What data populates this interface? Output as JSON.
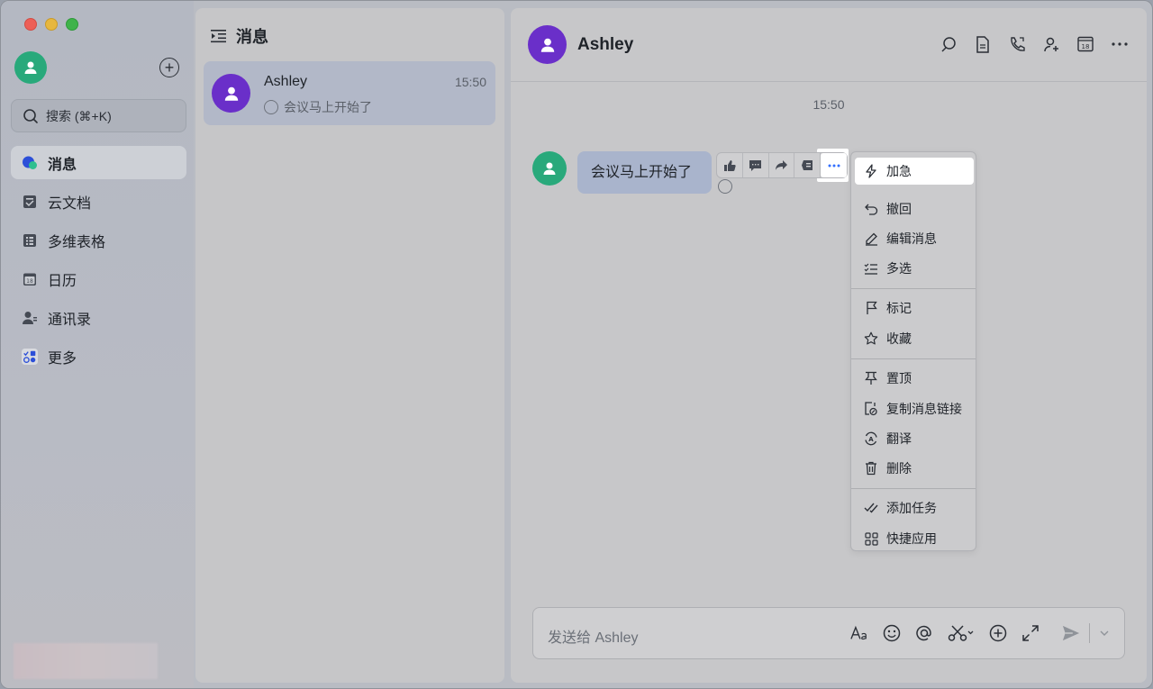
{
  "nav": {
    "search_placeholder": "搜索 (⌘+K)",
    "items": [
      {
        "label": "消息",
        "icon": "messenger-icon",
        "active": true
      },
      {
        "label": "云文档",
        "icon": "docs-icon"
      },
      {
        "label": "多维表格",
        "icon": "base-icon"
      },
      {
        "label": "日历",
        "icon": "calendar-icon"
      },
      {
        "label": "通讯录",
        "icon": "contacts-icon"
      },
      {
        "label": "更多",
        "icon": "more-apps-icon"
      }
    ]
  },
  "chat_list": {
    "title": "消息",
    "items": [
      {
        "name": "Ashley",
        "time": "15:50",
        "preview": "会议马上开始了"
      }
    ]
  },
  "conversation": {
    "name": "Ashley",
    "timestamp": "15:50",
    "message": "会议马上开始了",
    "input_placeholder": "发送给 Ashley"
  },
  "menu": {
    "items": [
      {
        "label": "加急",
        "icon": "lightning-icon",
        "highlight": true
      },
      {
        "label": "撤回",
        "icon": "undo-icon"
      },
      {
        "label": "编辑消息",
        "icon": "edit-icon"
      },
      {
        "label": "多选",
        "icon": "multiselect-icon"
      },
      {
        "label": "标记",
        "icon": "flag-icon"
      },
      {
        "label": "收藏",
        "icon": "star-icon"
      },
      {
        "label": "置顶",
        "icon": "pin-icon"
      },
      {
        "label": "复制消息链接",
        "icon": "link-icon"
      },
      {
        "label": "翻译",
        "icon": "translate-icon"
      },
      {
        "label": "删除",
        "icon": "trash-icon"
      },
      {
        "label": "添加任务",
        "icon": "task-icon"
      },
      {
        "label": "快捷应用",
        "icon": "apps-icon"
      }
    ]
  },
  "colors": {
    "accent": "#3370ff",
    "avatar_purple": "#6a2fc9",
    "avatar_green": "#29a97b"
  }
}
